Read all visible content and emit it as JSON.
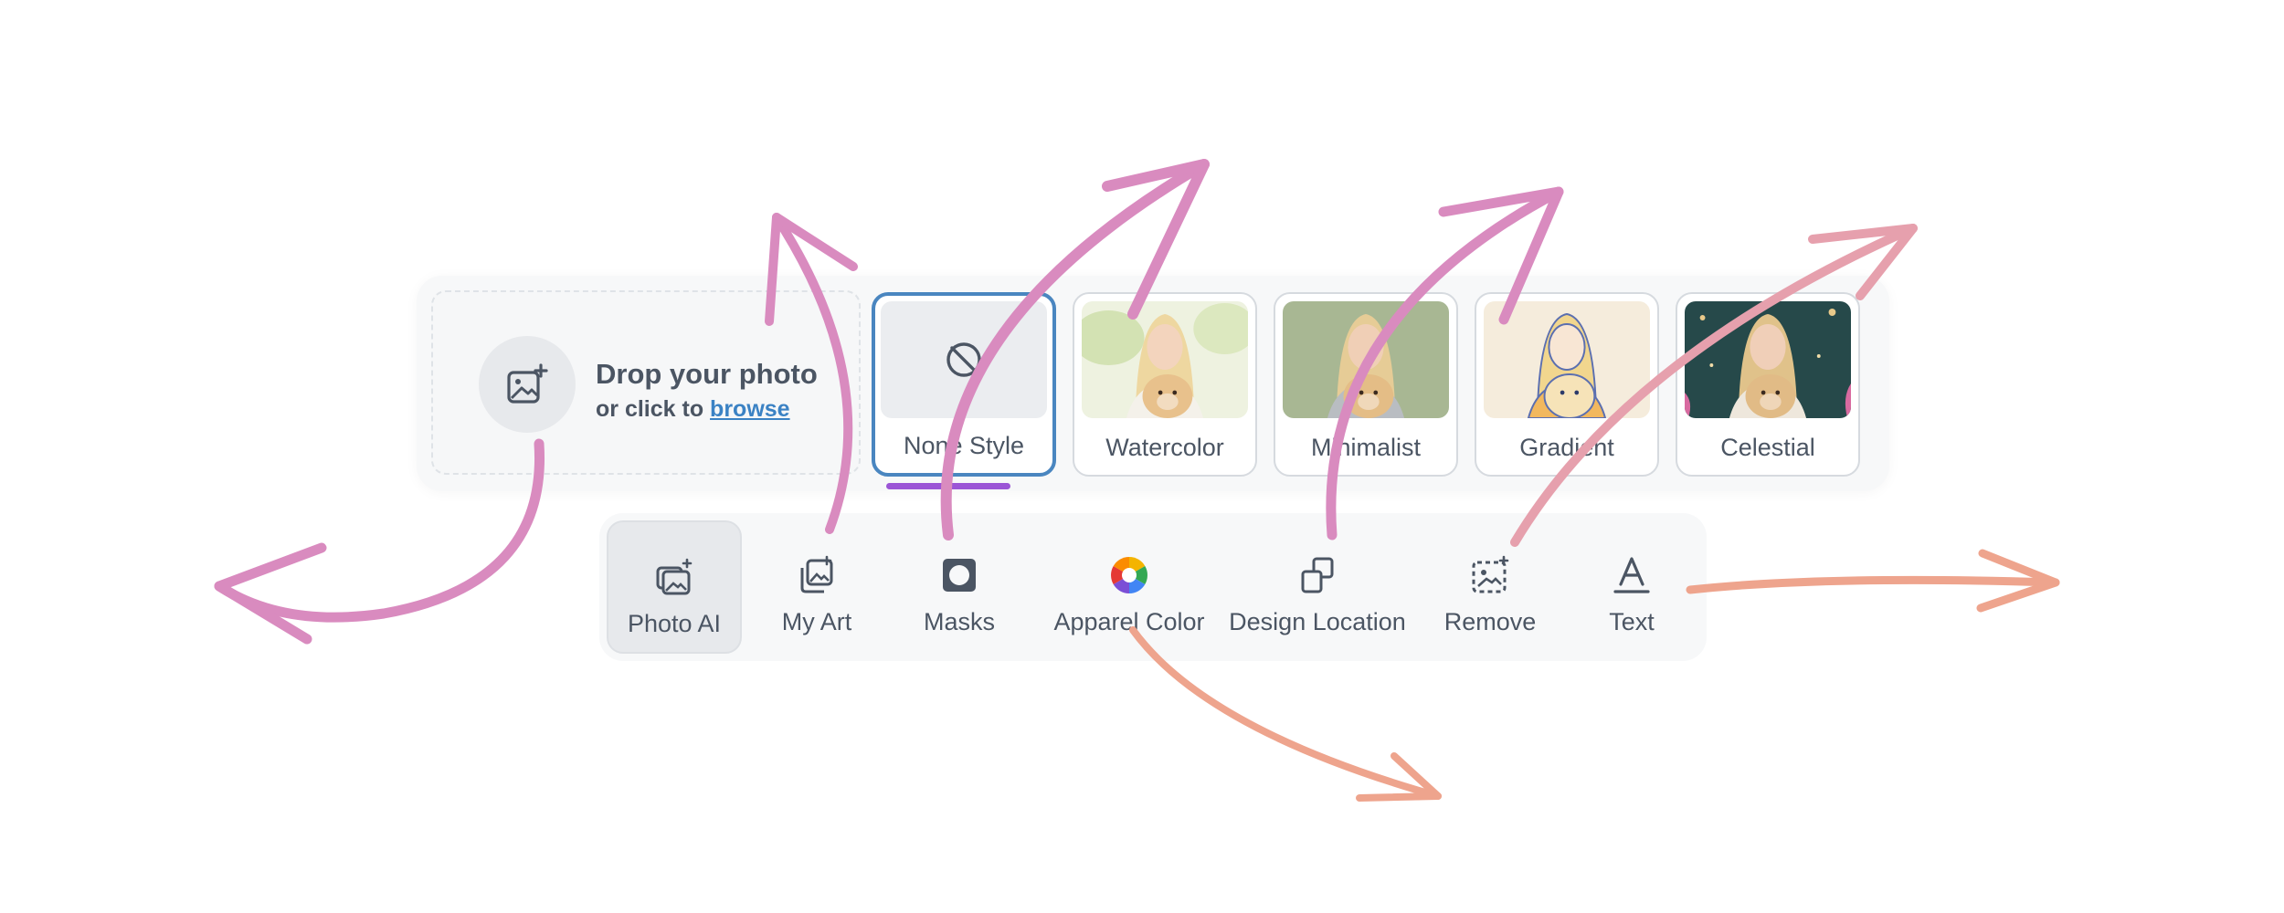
{
  "dropzone": {
    "title": "Drop your photo",
    "prefix": "or click to",
    "link": "browse"
  },
  "styles": [
    {
      "label": "None Style",
      "selected": true
    },
    {
      "label": "Watercolor"
    },
    {
      "label": "Minimalist"
    },
    {
      "label": "Gradient"
    },
    {
      "label": "Celestial"
    }
  ],
  "tools": [
    {
      "label": "Photo AI",
      "icon": "photo-ai-icon",
      "active": true
    },
    {
      "label": "My Art",
      "icon": "my-art-icon"
    },
    {
      "label": "Masks",
      "icon": "mask-icon"
    },
    {
      "label": "Apparel Color",
      "icon": "color-wheel-icon"
    },
    {
      "label": "Design Location",
      "icon": "design-location-icon"
    },
    {
      "label": "Remove",
      "icon": "remove-background-icon"
    },
    {
      "label": "Text",
      "icon": "text-icon"
    }
  ],
  "colors": {
    "accent": "#4a86c0",
    "selected_underline": "#9b55d6",
    "arrow_pink": "#d98bbf",
    "arrow_peach": "#eea48d"
  }
}
